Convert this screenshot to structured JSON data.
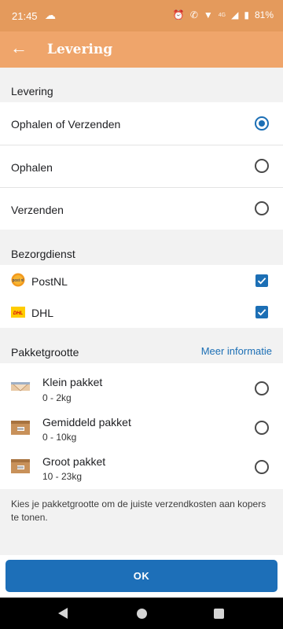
{
  "status_bar": {
    "time": "21:45",
    "network": "4G",
    "battery": "81%",
    "icons": [
      "cloud-icon",
      "alarm-icon",
      "wifi-call-icon",
      "wifi-icon",
      "signal-icon",
      "battery-icon"
    ]
  },
  "app_bar": {
    "title": "Levering",
    "back_icon": "arrow-left-icon"
  },
  "delivery": {
    "heading": "Levering",
    "options": [
      {
        "label": "Ophalen of Verzenden",
        "selected": true
      },
      {
        "label": "Ophalen",
        "selected": false
      },
      {
        "label": "Verzenden",
        "selected": false
      }
    ]
  },
  "carriers": {
    "heading": "Bezorgdienst",
    "items": [
      {
        "name": "PostNL",
        "checked": true,
        "logo": "postnl-logo",
        "logo_text": "post nl"
      },
      {
        "name": "DHL",
        "checked": true,
        "logo": "dhl-logo",
        "logo_text": "DHL"
      }
    ]
  },
  "packages": {
    "heading": "Pakketgrootte",
    "more_link": "Meer informatie",
    "items": [
      {
        "title": "Klein pakket",
        "range": "0 - 2kg",
        "selected": false,
        "icon": "envelope-package-icon"
      },
      {
        "title": "Gemiddeld pakket",
        "range": "0 - 10kg",
        "selected": false,
        "icon": "box-package-icon"
      },
      {
        "title": "Groot pakket",
        "range": "10 - 23kg",
        "selected": false,
        "icon": "box-package-icon"
      }
    ],
    "hint": "Kies je pakketgrootte om de juiste verzendkosten aan kopers te tonen."
  },
  "footer": {
    "ok_label": "OK"
  },
  "colors": {
    "status_bar": "#e49a5c",
    "app_bar": "#efa56b",
    "accent": "#1c6fb5",
    "background": "#f2f2f2"
  }
}
